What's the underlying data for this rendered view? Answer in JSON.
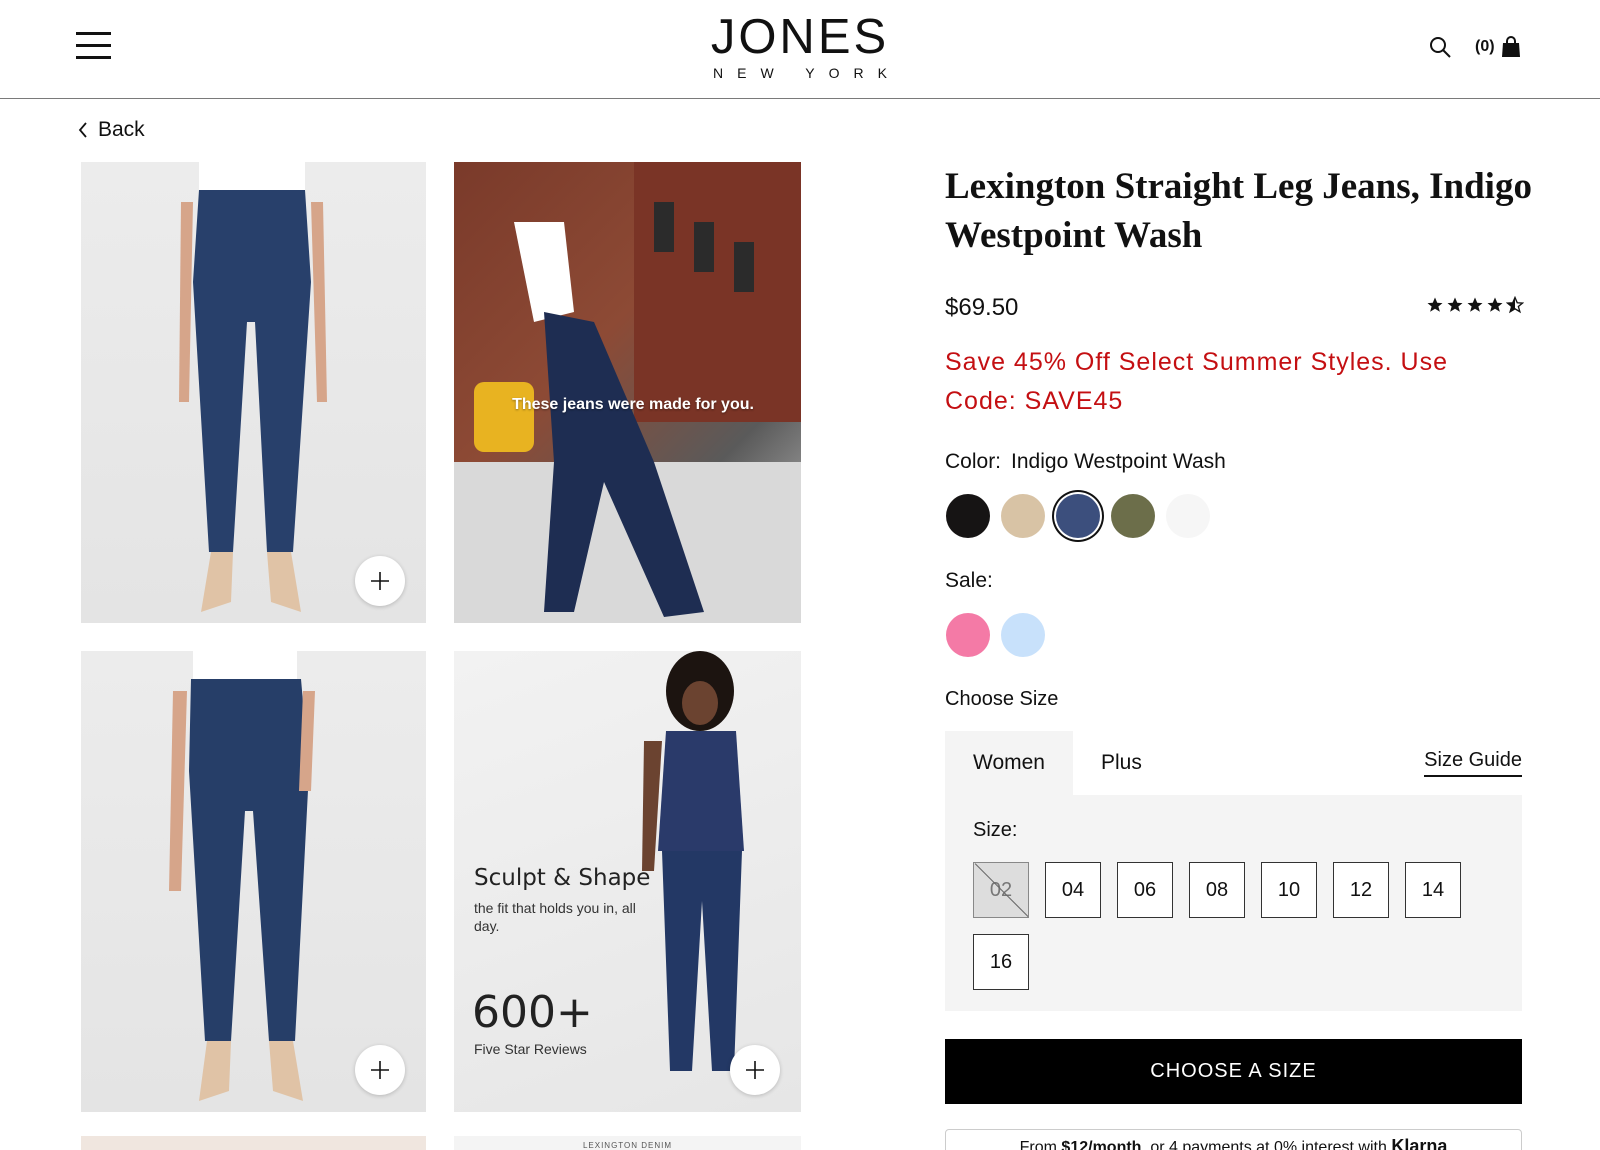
{
  "header": {
    "logo_main": "JONES",
    "logo_sub": "NEW YORK",
    "cart_count": "(0)"
  },
  "nav": {
    "back_label": "Back"
  },
  "gallery": {
    "overlay_text": "These jeans were made for you.",
    "promo_title": "Sculpt & Shape",
    "promo_sub": "the fit that holds you in, all day.",
    "promo_number": "600+",
    "promo_caption": "Five Star Reviews",
    "denim_label": "LEXINGTON DENIM"
  },
  "product": {
    "title": "Lexington Straight Leg Jeans, Indigo Westpoint Wash",
    "price": "$69.50",
    "rating": 4.5,
    "promo": "Save 45% Off Select Summer Styles. Use Code: SAVE45",
    "color_label": "Color:",
    "color_value": "Indigo Westpoint Wash",
    "colors": [
      "#161414",
      "#d8c3a5",
      "#3c4f7d",
      "#6c6e4a",
      "#f6f6f6"
    ],
    "sale_label": "Sale:",
    "sale_colors": [
      "#f47aa6",
      "#c8e1fb"
    ],
    "choose_size_label": "Choose Size"
  },
  "sizes": {
    "tab_women": "Women",
    "tab_plus": "Plus",
    "size_guide": "Size Guide",
    "size_label": "Size:",
    "options": [
      "02",
      "04",
      "06",
      "08",
      "10",
      "12",
      "14",
      "16"
    ],
    "unavailable": [
      "02"
    ]
  },
  "cta_label": "CHOOSE A SIZE",
  "klarna": {
    "prefix": "From ",
    "amount": "$12/month",
    "middle": ", or 4 payments at 0% interest with ",
    "brand": "Klarna"
  }
}
